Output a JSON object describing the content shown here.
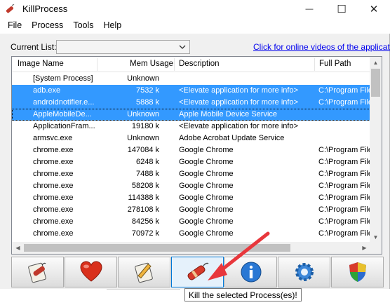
{
  "window": {
    "title": "KillProcess",
    "minimize_glyph": "—",
    "maximize_glyph": "☐",
    "close_glyph": "✕"
  },
  "menu": [
    "File",
    "Process",
    "Tools",
    "Help"
  ],
  "current_list": {
    "label": "Current List:",
    "value": ""
  },
  "video_link": "Click for online videos of the application",
  "columns": [
    "Image Name",
    "Mem Usage",
    "Description",
    "Full Path"
  ],
  "processes": [
    {
      "name": "[System Process]",
      "mem": "Unknown",
      "desc": "",
      "path": "",
      "state": "normal"
    },
    {
      "name": "adb.exe",
      "mem": "7532 k",
      "desc": "<Elevate application for more info>",
      "path": "C:\\Program File",
      "state": "selected"
    },
    {
      "name": "androidnotifier.e...",
      "mem": "5888 k",
      "desc": "<Elevate application for more info>",
      "path": "C:\\Program File",
      "state": "selected"
    },
    {
      "name": "AppleMobileDe...",
      "mem": "Unknown",
      "desc": "Apple Mobile Device Service",
      "path": "",
      "state": "focused"
    },
    {
      "name": "ApplicationFram...",
      "mem": "19180 k",
      "desc": "<Elevate application for more info>",
      "path": "",
      "state": "normal"
    },
    {
      "name": "armsvc.exe",
      "mem": "Unknown",
      "desc": "Adobe Acrobat Update Service",
      "path": "",
      "state": "normal"
    },
    {
      "name": "chrome.exe",
      "mem": "147084 k",
      "desc": "Google Chrome",
      "path": "C:\\Program File",
      "state": "normal"
    },
    {
      "name": "chrome.exe",
      "mem": "6248 k",
      "desc": "Google Chrome",
      "path": "C:\\Program File",
      "state": "normal"
    },
    {
      "name": "chrome.exe",
      "mem": "7488 k",
      "desc": "Google Chrome",
      "path": "C:\\Program File",
      "state": "normal"
    },
    {
      "name": "chrome.exe",
      "mem": "58208 k",
      "desc": "Google Chrome",
      "path": "C:\\Program File",
      "state": "normal"
    },
    {
      "name": "chrome.exe",
      "mem": "114388 k",
      "desc": "Google Chrome",
      "path": "C:\\Program File",
      "state": "normal"
    },
    {
      "name": "chrome.exe",
      "mem": "278108 k",
      "desc": "Google Chrome",
      "path": "C:\\Program File",
      "state": "normal"
    },
    {
      "name": "chrome.exe",
      "mem": "84256 k",
      "desc": "Google Chrome",
      "path": "C:\\Program File",
      "state": "normal"
    },
    {
      "name": "chrome.exe",
      "mem": "70972 k",
      "desc": "Google Chrome",
      "path": "C:\\Program File",
      "state": "normal"
    }
  ],
  "toolbar": [
    {
      "icon": "notepad-dynamite-icon"
    },
    {
      "icon": "heart-icon"
    },
    {
      "icon": "notepad-pencil-icon"
    },
    {
      "icon": "dynamite-icon",
      "active": true
    },
    {
      "icon": "info-icon"
    },
    {
      "icon": "gear-icon"
    },
    {
      "icon": "shield-icon"
    }
  ],
  "tooltip": "Kill the selected Process(es)!",
  "colors": {
    "selection": "#3399ff",
    "link": "#0000ee",
    "annotation_arrow": "#e8373c"
  }
}
